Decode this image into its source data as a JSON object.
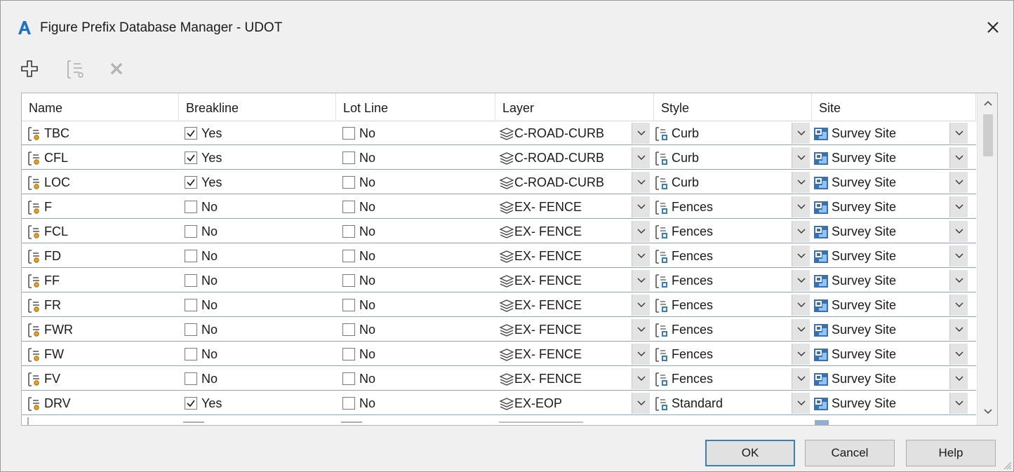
{
  "window": {
    "title": "Figure Prefix Database Manager - UDOT"
  },
  "toolbar": {
    "buttons": [
      "new-prefix",
      "copy-prefix",
      "delete-prefix"
    ]
  },
  "columns": [
    "Name",
    "Breakline",
    "Lot Line",
    "Layer",
    "Style",
    "Site"
  ],
  "rows": [
    {
      "name": "TBC",
      "breakline_checked": true,
      "breakline": "Yes",
      "lotline_checked": false,
      "lotline": "No",
      "layer": "C-ROAD-CURB",
      "style": "Curb",
      "site": "Survey Site"
    },
    {
      "name": "CFL",
      "breakline_checked": true,
      "breakline": "Yes",
      "lotline_checked": false,
      "lotline": "No",
      "layer": "C-ROAD-CURB",
      "style": "Curb",
      "site": "Survey Site"
    },
    {
      "name": "LOC",
      "breakline_checked": true,
      "breakline": "Yes",
      "lotline_checked": false,
      "lotline": "No",
      "layer": "C-ROAD-CURB",
      "style": "Curb",
      "site": "Survey Site"
    },
    {
      "name": "F",
      "breakline_checked": false,
      "breakline": "No",
      "lotline_checked": false,
      "lotline": "No",
      "layer": "EX- FENCE",
      "style": "Fences",
      "site": "Survey Site"
    },
    {
      "name": "FCL",
      "breakline_checked": false,
      "breakline": "No",
      "lotline_checked": false,
      "lotline": "No",
      "layer": "EX- FENCE",
      "style": "Fences",
      "site": "Survey Site"
    },
    {
      "name": "FD",
      "breakline_checked": false,
      "breakline": "No",
      "lotline_checked": false,
      "lotline": "No",
      "layer": "EX- FENCE",
      "style": "Fences",
      "site": "Survey Site"
    },
    {
      "name": "FF",
      "breakline_checked": false,
      "breakline": "No",
      "lotline_checked": false,
      "lotline": "No",
      "layer": "EX- FENCE",
      "style": "Fences",
      "site": "Survey Site"
    },
    {
      "name": "FR",
      "breakline_checked": false,
      "breakline": "No",
      "lotline_checked": false,
      "lotline": "No",
      "layer": "EX- FENCE",
      "style": "Fences",
      "site": "Survey Site"
    },
    {
      "name": "FWR",
      "breakline_checked": false,
      "breakline": "No",
      "lotline_checked": false,
      "lotline": "No",
      "layer": "EX- FENCE",
      "style": "Fences",
      "site": "Survey Site"
    },
    {
      "name": "FW",
      "breakline_checked": false,
      "breakline": "No",
      "lotline_checked": false,
      "lotline": "No",
      "layer": "EX- FENCE",
      "style": "Fences",
      "site": "Survey Site"
    },
    {
      "name": "FV",
      "breakline_checked": false,
      "breakline": "No",
      "lotline_checked": false,
      "lotline": "No",
      "layer": "EX- FENCE",
      "style": "Fences",
      "site": "Survey Site"
    },
    {
      "name": "DRV",
      "breakline_checked": true,
      "breakline": "Yes",
      "lotline_checked": false,
      "lotline": "No",
      "layer": "EX-EOP",
      "style": "Standard",
      "site": "Survey Site"
    }
  ],
  "footer": {
    "ok": "OK",
    "cancel": "Cancel",
    "help": "Help"
  },
  "colors": {
    "accent": "#3c7fb1",
    "row_border": "#8ba4c8",
    "dropdown_bg": "#e3e3e3",
    "app_icon": "#1e73c8"
  }
}
